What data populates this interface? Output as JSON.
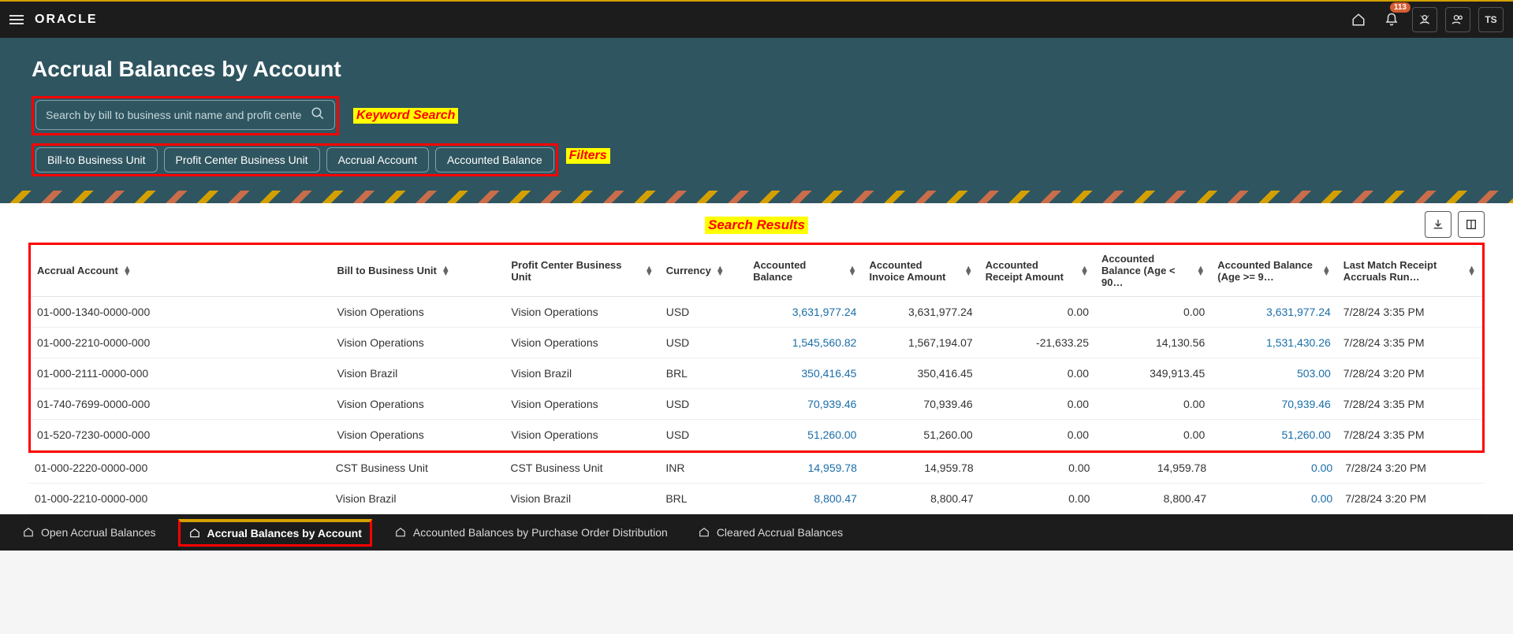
{
  "header": {
    "logo": "ORACLE",
    "notif_count": "113",
    "avatar": "TS"
  },
  "page": {
    "title": "Accrual Balances by Account",
    "search_placeholder": "Search by bill to business unit name and profit cente"
  },
  "filters": [
    "Bill-to Business Unit",
    "Profit Center Business Unit",
    "Accrual Account",
    "Accounted Balance"
  ],
  "annotations": {
    "keyword_search": "Keyword Search",
    "filters": "Filters",
    "search_results": "Search Results"
  },
  "columns": [
    {
      "key": "acct",
      "label": "Accrual Account",
      "align": "left"
    },
    {
      "key": "billto",
      "label": "Bill to Business Unit",
      "align": "left"
    },
    {
      "key": "profit",
      "label": "Profit Center Business Unit",
      "align": "left"
    },
    {
      "key": "currency",
      "label": "Currency",
      "align": "left"
    },
    {
      "key": "bal",
      "label": "Accounted Balance",
      "align": "right"
    },
    {
      "key": "invamt",
      "label": "Accounted Invoice Amount",
      "align": "right"
    },
    {
      "key": "rcptamt",
      "label": "Accounted Receipt Amount",
      "align": "right"
    },
    {
      "key": "lt90",
      "label": "Accounted Balance (Age < 90…",
      "align": "right"
    },
    {
      "key": "ge90",
      "label": "Accounted Balance (Age >= 9…",
      "align": "right"
    },
    {
      "key": "lastrun",
      "label": "Last Match Receipt Accruals Run…",
      "align": "left"
    }
  ],
  "rows_boxed": [
    {
      "acct": "01-000-1340-0000-000",
      "billto": "Vision Operations",
      "profit": "Vision Operations",
      "currency": "USD",
      "bal": "3,631,977.24",
      "invamt": "3,631,977.24",
      "rcptamt": "0.00",
      "lt90": "0.00",
      "ge90": "3,631,977.24",
      "lastrun": "7/28/24 3:35 PM"
    },
    {
      "acct": "01-000-2210-0000-000",
      "billto": "Vision Operations",
      "profit": "Vision Operations",
      "currency": "USD",
      "bal": "1,545,560.82",
      "invamt": "1,567,194.07",
      "rcptamt": "-21,633.25",
      "lt90": "14,130.56",
      "ge90": "1,531,430.26",
      "lastrun": "7/28/24 3:35 PM"
    },
    {
      "acct": "01-000-2111-0000-000",
      "billto": "Vision Brazil",
      "profit": "Vision Brazil",
      "currency": "BRL",
      "bal": "350,416.45",
      "invamt": "350,416.45",
      "rcptamt": "0.00",
      "lt90": "349,913.45",
      "ge90": "503.00",
      "lastrun": "7/28/24 3:20 PM"
    },
    {
      "acct": "01-740-7699-0000-000",
      "billto": "Vision Operations",
      "profit": "Vision Operations",
      "currency": "USD",
      "bal": "70,939.46",
      "invamt": "70,939.46",
      "rcptamt": "0.00",
      "lt90": "0.00",
      "ge90": "70,939.46",
      "lastrun": "7/28/24 3:35 PM"
    },
    {
      "acct": "01-520-7230-0000-000",
      "billto": "Vision Operations",
      "profit": "Vision Operations",
      "currency": "USD",
      "bal": "51,260.00",
      "invamt": "51,260.00",
      "rcptamt": "0.00",
      "lt90": "0.00",
      "ge90": "51,260.00",
      "lastrun": "7/28/24 3:35 PM"
    }
  ],
  "rows_after": [
    {
      "acct": "01-000-2220-0000-000",
      "billto": "CST Business Unit",
      "profit": "CST Business Unit",
      "currency": "INR",
      "bal": "14,959.78",
      "invamt": "14,959.78",
      "rcptamt": "0.00",
      "lt90": "14,959.78",
      "ge90": "0.00",
      "lastrun": "7/28/24 3:20 PM"
    },
    {
      "acct": "01-000-2210-0000-000",
      "billto": "Vision Brazil",
      "profit": "Vision Brazil",
      "currency": "BRL",
      "bal": "8,800.47",
      "invamt": "8,800.47",
      "rcptamt": "0.00",
      "lt90": "8,800.47",
      "ge90": "0.00",
      "lastrun": "7/28/24 3:20 PM"
    }
  ],
  "bottom_tabs": [
    {
      "label": "Open Accrual Balances",
      "active": false
    },
    {
      "label": "Accrual Balances by Account",
      "active": true
    },
    {
      "label": "Accounted Balances by Purchase Order Distribution",
      "active": false
    },
    {
      "label": "Cleared Accrual Balances",
      "active": false
    }
  ]
}
